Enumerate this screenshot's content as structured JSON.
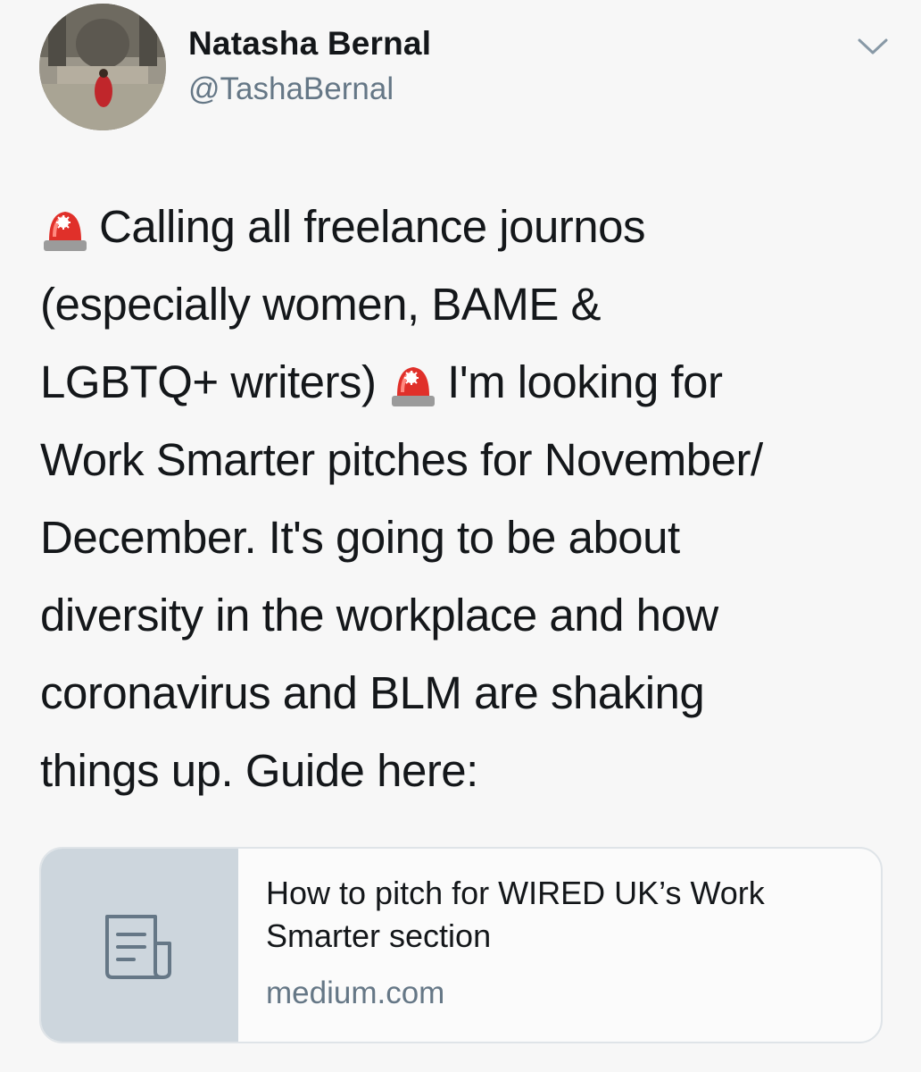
{
  "author": {
    "name": "Natasha Bernal",
    "handle": "@TashaBernal",
    "avatar_icon": "profile-photo"
  },
  "header": {
    "menu_icon": "chevron-down-icon"
  },
  "tweet": {
    "emoji_icon": "police-car-light-icon",
    "line1": "Calling all freelance journos",
    "line2": "(especially women, BAME &",
    "line3_a": "LGBTQ+ writers)",
    "line3_b": "I'm looking for",
    "line4": "Work Smarter pitches for November/",
    "line5": "December. It's going to be about",
    "line6": "diversity in the workplace and how",
    "line7": "coronavirus and BLM are shaking",
    "line8": "things up. Guide here:"
  },
  "link_card": {
    "thumbnail_icon": "document-icon",
    "title_line1": "How to pitch for WIRED UK’s Work",
    "title_line2": "Smarter section",
    "domain": "medium.com"
  },
  "colors": {
    "text": "#14171a",
    "secondary": "#657786",
    "card_thumb": "#cdd6dd",
    "card_border": "#dfe4e8",
    "background": "#f7f7f7"
  }
}
